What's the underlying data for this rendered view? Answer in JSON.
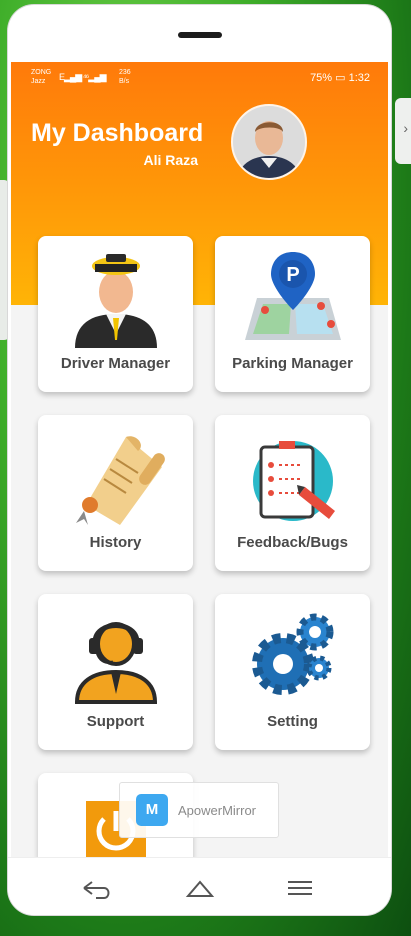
{
  "status_bar": {
    "carrier_line1": "ZONG",
    "carrier_line2": "Jazz",
    "signal": "E▂▄▆ ⁴⁶▂▄▆",
    "net_speed": "236",
    "net_unit": "B/s",
    "right_status": "75% ▭ 1:32"
  },
  "header": {
    "title": "My Dashboard",
    "user_name": "Ali Raza"
  },
  "cards": [
    {
      "label": "Driver Manager",
      "icon": "driver-icon"
    },
    {
      "label": "Parking Manager",
      "icon": "parking-map-icon"
    },
    {
      "label": "History",
      "icon": "scroll-icon"
    },
    {
      "label": "Feedback/Bugs",
      "icon": "clipboard-icon"
    },
    {
      "label": "Support",
      "icon": "headset-support-icon"
    },
    {
      "label": "Setting",
      "icon": "gears-icon"
    },
    {
      "label": "",
      "icon": "power-icon"
    }
  ],
  "watermark": {
    "text": "ApowerMirror"
  },
  "navbar": {
    "back_icon": "back-arrow-icon",
    "home_icon": "home-icon",
    "menu_icon": "menu-icon"
  },
  "colors": {
    "header_top": "#ff7a0a",
    "header_bottom": "#ffb406",
    "card_label": "#4a4a4a"
  }
}
